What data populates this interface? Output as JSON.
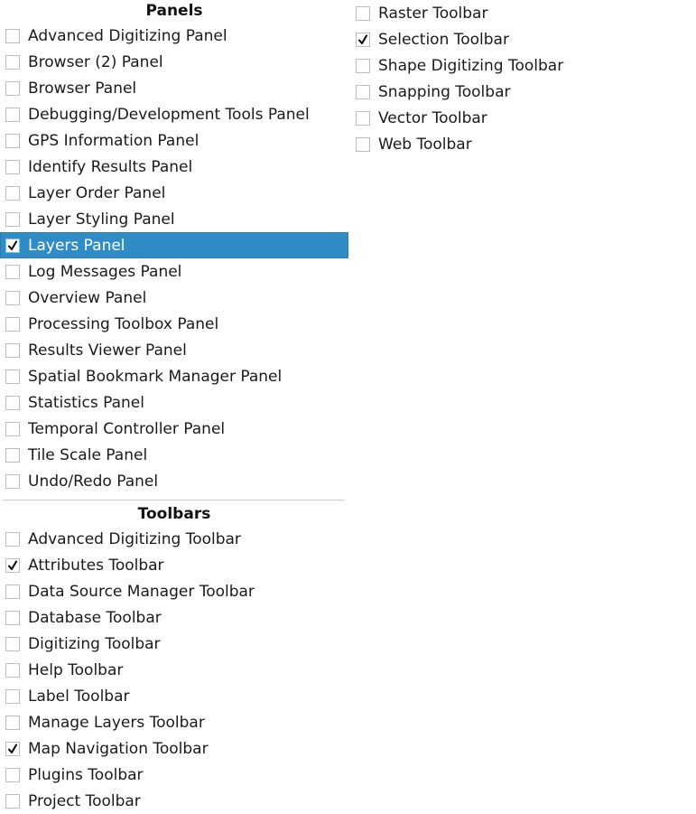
{
  "panels": {
    "header": "Panels",
    "items": [
      {
        "label": "Advanced Digitizing Panel",
        "checked": false,
        "selected": false
      },
      {
        "label": "Browser (2) Panel",
        "checked": false,
        "selected": false
      },
      {
        "label": "Browser Panel",
        "checked": false,
        "selected": false
      },
      {
        "label": "Debugging/Development Tools Panel",
        "checked": false,
        "selected": false
      },
      {
        "label": "GPS Information Panel",
        "checked": false,
        "selected": false
      },
      {
        "label": "Identify Results Panel",
        "checked": false,
        "selected": false
      },
      {
        "label": "Layer Order Panel",
        "checked": false,
        "selected": false
      },
      {
        "label": "Layer Styling Panel",
        "checked": false,
        "selected": false
      },
      {
        "label": "Layers Panel",
        "checked": true,
        "selected": true
      },
      {
        "label": "Log Messages Panel",
        "checked": false,
        "selected": false
      },
      {
        "label": "Overview Panel",
        "checked": false,
        "selected": false
      },
      {
        "label": "Processing Toolbox Panel",
        "checked": false,
        "selected": false
      },
      {
        "label": "Results Viewer Panel",
        "checked": false,
        "selected": false
      },
      {
        "label": "Spatial Bookmark Manager Panel",
        "checked": false,
        "selected": false
      },
      {
        "label": "Statistics Panel",
        "checked": false,
        "selected": false
      },
      {
        "label": "Temporal Controller Panel",
        "checked": false,
        "selected": false
      },
      {
        "label": "Tile Scale Panel",
        "checked": false,
        "selected": false
      },
      {
        "label": "Undo/Redo Panel",
        "checked": false,
        "selected": false
      }
    ]
  },
  "toolbars": {
    "header": "Toolbars",
    "items": [
      {
        "label": "Advanced Digitizing Toolbar",
        "checked": false
      },
      {
        "label": "Attributes Toolbar",
        "checked": true
      },
      {
        "label": "Data Source Manager Toolbar",
        "checked": false
      },
      {
        "label": "Database Toolbar",
        "checked": false
      },
      {
        "label": "Digitizing Toolbar",
        "checked": false
      },
      {
        "label": "Help Toolbar",
        "checked": false
      },
      {
        "label": "Label Toolbar",
        "checked": false
      },
      {
        "label": "Manage Layers Toolbar",
        "checked": false
      },
      {
        "label": "Map Navigation Toolbar",
        "checked": true
      },
      {
        "label": "Plugins Toolbar",
        "checked": false
      },
      {
        "label": "Project Toolbar",
        "checked": false
      }
    ],
    "items_column2": [
      {
        "label": "Raster Toolbar",
        "checked": false
      },
      {
        "label": "Selection Toolbar",
        "checked": true
      },
      {
        "label": "Shape Digitizing Toolbar",
        "checked": false
      },
      {
        "label": "Snapping Toolbar",
        "checked": false
      },
      {
        "label": "Vector Toolbar",
        "checked": false
      },
      {
        "label": "Web Toolbar",
        "checked": false
      }
    ]
  },
  "colors": {
    "selection_background": "#308cc6",
    "selection_text": "#ffffff"
  }
}
